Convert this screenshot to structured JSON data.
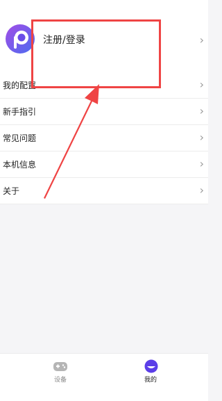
{
  "profile": {
    "login_label": "注册/登录",
    "chevron": "›",
    "avatar_icon": "app-avatar-icon"
  },
  "menu": {
    "items": [
      {
        "label": "我的配置",
        "chevron": "›"
      },
      {
        "label": "新手指引",
        "chevron": "›"
      },
      {
        "label": "常见问题",
        "chevron": "›"
      },
      {
        "label": "本机信息",
        "chevron": "›"
      },
      {
        "label": "关于",
        "chevron": "›"
      }
    ]
  },
  "tabbar": {
    "tabs": [
      {
        "label": "设备",
        "icon": "gamepad-icon",
        "active": false
      },
      {
        "label": "我的",
        "icon": "profile-face-icon",
        "active": true
      }
    ]
  },
  "colors": {
    "annotation_red": "#ef4444",
    "avatar_purple": "#8a4de8",
    "avatar_blue": "#4b6cf0",
    "active_icon": "#5b3ee8",
    "inactive_icon": "#b5b5b5"
  }
}
